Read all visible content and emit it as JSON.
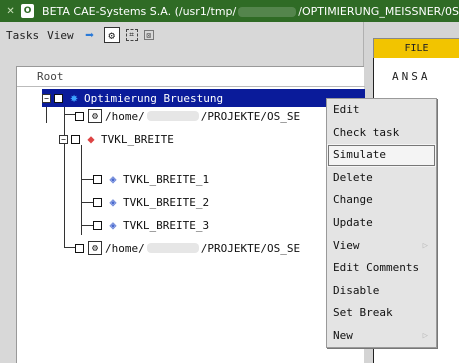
{
  "window": {
    "title_prefix": "BETA CAE-Systems S.A. (/usr1/tmp/",
    "title_suffix": "/OPTIMIERUNG_MEISSNER/0S",
    "close_glyph": "✕",
    "menu_glyph": "O"
  },
  "toolbar": {
    "tasks_label": "Tasks",
    "view_label": "View",
    "arrow_glyph": "➡",
    "gear_glyph": "⚙",
    "frame_glyph": "⌗",
    "box_glyph": "⊠"
  },
  "tree": {
    "root_label": "Root",
    "rows": [
      {
        "label": "Optimierung Bruestung",
        "icon": "optimization-icon",
        "glyph": "✸"
      },
      {
        "label_prefix": "/home/",
        "label_suffix": "/PROJEKTE/OS_SE",
        "icon": "file-gear-icon",
        "glyph": "⚙"
      },
      {
        "label": "TVKL_BREITE",
        "icon": "tvkl-icon",
        "glyph": "◆"
      },
      {
        "label": "TVKL_BREITE_1",
        "icon": "tvkl-variant-icon",
        "glyph": "◈"
      },
      {
        "label": "TVKL_BREITE_2",
        "icon": "tvkl-variant-icon",
        "glyph": "◈"
      },
      {
        "label": "TVKL_BREITE_3",
        "icon": "tvkl-variant-icon",
        "glyph": "◈"
      },
      {
        "label_prefix": "/home/",
        "label_suffix": "/PROJEKTE/OS_SE",
        "icon": "file-gear-icon",
        "glyph": "⚙"
      }
    ],
    "expand_minus": "−"
  },
  "right": {
    "file_label": "FILE",
    "ansa_text": "ANSA"
  },
  "context_menu": {
    "items": [
      {
        "label": "Edit",
        "submenu": false
      },
      {
        "label": "Check task",
        "submenu": false
      },
      {
        "label": "Simulate",
        "submenu": false,
        "highlighted": true
      },
      {
        "label": "Delete",
        "submenu": false
      },
      {
        "label": "Change",
        "submenu": false
      },
      {
        "label": "Update",
        "submenu": false
      },
      {
        "label": "View",
        "submenu": true
      },
      {
        "label": "Edit Comments",
        "submenu": false
      },
      {
        "label": "Disable",
        "submenu": false
      },
      {
        "label": "Set Break",
        "submenu": false
      },
      {
        "label": "New",
        "submenu": true
      }
    ],
    "submenu_glyph": "▷"
  },
  "colors": {
    "titlebar": "#2f6b25",
    "selection": "#0a1b9a",
    "file_button": "#f2c400"
  }
}
